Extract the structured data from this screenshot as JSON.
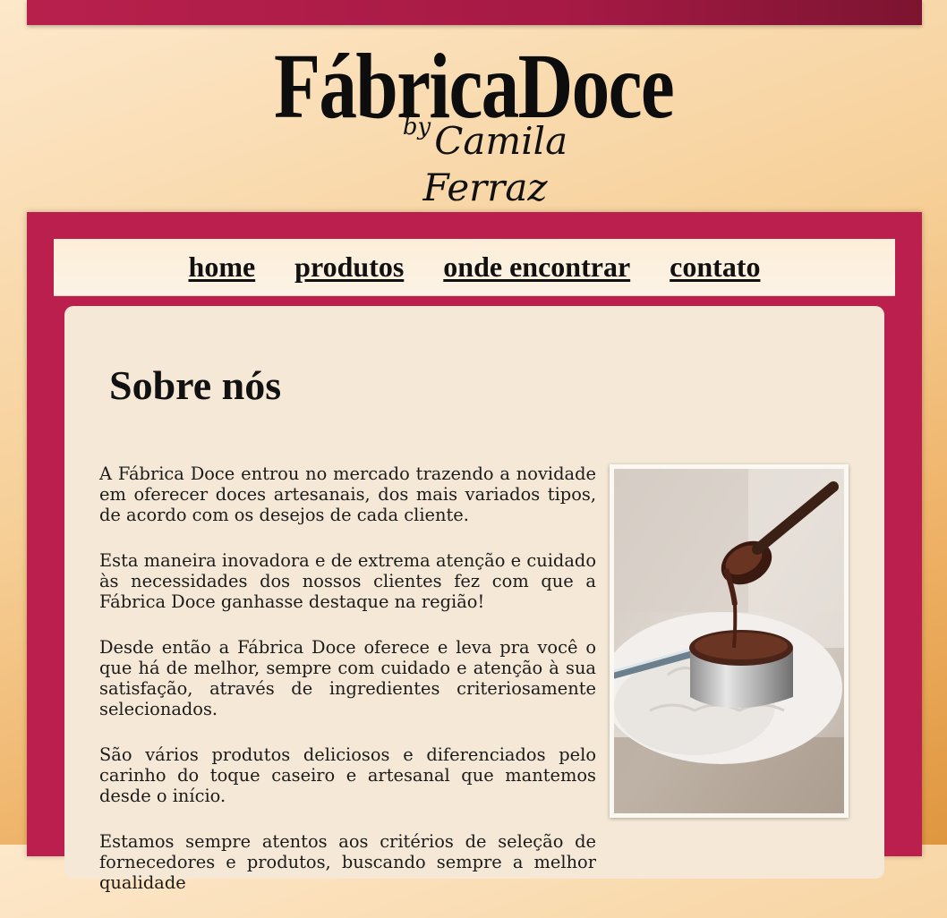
{
  "brand": {
    "name": "FábricaDoce",
    "tagline_by": "by",
    "tagline_name": "Camila Ferraz"
  },
  "nav": {
    "items": [
      {
        "label": "home"
      },
      {
        "label": "produtos"
      },
      {
        "label": "onde encontrar"
      },
      {
        "label": "contato"
      }
    ]
  },
  "about": {
    "title": "Sobre nós",
    "paragraphs": [
      "A Fábrica Doce entrou no mercado trazendo a novidade em oferecer doces artesanais, dos mais variados tipos, de acordo com os desejos de cada cliente.",
      "Esta maneira inovadora e de extrema atenção e cuidado às necessidades dos nossos clientes fez com que a Fábrica Doce ganhasse destaque na região!",
      "Desde então a Fábrica Doce oferece e leva pra você o que há de melhor, sempre com cuidado e atenção à sua satisfação, através de ingredientes criteriosamente selecionados.",
      "São vários produtos deliciosos e diferenciados pelo carinho do toque caseiro e artesanal que mantemos desde o início.",
      "Estamos sempre atentos aos critérios de seleção de fornecedores e produtos, buscando sempre a melhor qualidade"
    ]
  },
  "colors": {
    "brand_red": "#ba1f4e",
    "panel_bg": "#f5e8d6",
    "nav_bg": "#fdeed8"
  }
}
